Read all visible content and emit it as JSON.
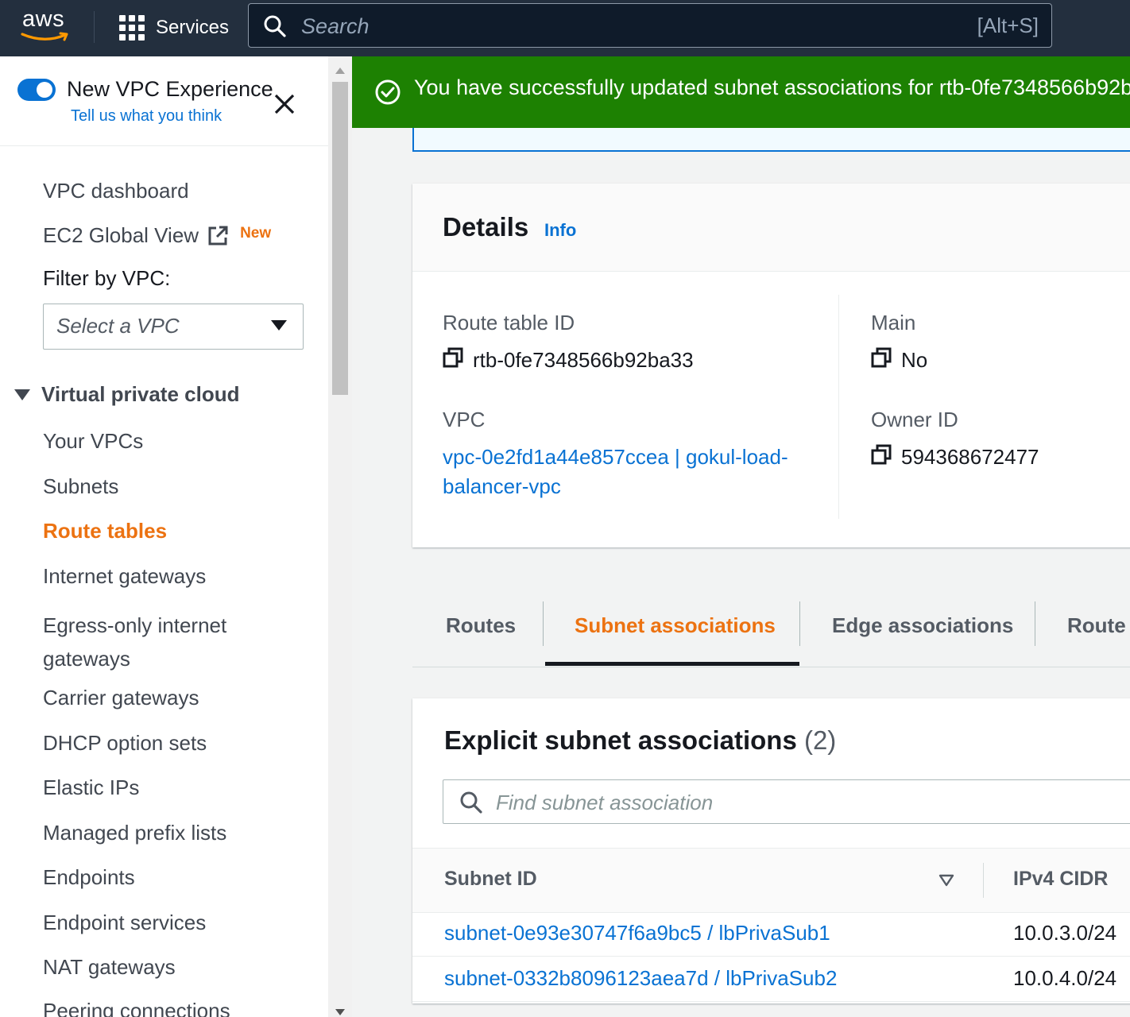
{
  "topnav": {
    "logo_text": "aws",
    "services_label": "Services",
    "search_placeholder": "Search",
    "search_shortcut": "[Alt+S]"
  },
  "sidebar": {
    "toggle_title": "New VPC Experience",
    "toggle_subtitle": "Tell us what you think",
    "toggle_on": true,
    "links_top": [
      {
        "label": "VPC dashboard"
      },
      {
        "label": "EC2 Global View",
        "badge": "New"
      }
    ],
    "filter_label": "Filter by VPC:",
    "filter_placeholder": "Select a VPC",
    "section_title": "Virtual private cloud",
    "items": [
      {
        "label": "Your VPCs"
      },
      {
        "label": "Subnets"
      },
      {
        "label": "Route tables",
        "active": true
      },
      {
        "label": "Internet gateways"
      },
      {
        "label": "Egress-only internet gateways"
      },
      {
        "label": "Carrier gateways"
      },
      {
        "label": "DHCP option sets"
      },
      {
        "label": "Elastic IPs"
      },
      {
        "label": "Managed prefix lists"
      },
      {
        "label": "Endpoints"
      },
      {
        "label": "Endpoint services"
      },
      {
        "label": "NAT gateways"
      },
      {
        "label": "Peering connections"
      }
    ]
  },
  "flash": {
    "status": "success",
    "message": "You have successfully updated subnet associations for rtb-0fe7348566b92b"
  },
  "details": {
    "title": "Details",
    "info_label": "Info",
    "route_table_id_label": "Route table ID",
    "route_table_id": "rtb-0fe7348566b92ba33",
    "vpc_label": "VPC",
    "vpc_value": "vpc-0e2fd1a44e857ccea | gokul-load-balancer-vpc",
    "main_label": "Main",
    "main_value": "No",
    "owner_label": "Owner ID",
    "owner_value": "594368672477"
  },
  "tabs": [
    {
      "label": "Routes"
    },
    {
      "label": "Subnet associations",
      "active": true
    },
    {
      "label": "Edge associations"
    },
    {
      "label": "Route"
    }
  ],
  "associations": {
    "title": "Explicit subnet associations",
    "count": "(2)",
    "search_placeholder": "Find subnet association",
    "columns": [
      "Subnet ID",
      "IPv4 CIDR"
    ],
    "rows": [
      {
        "subnet": "subnet-0e93e30747f6a9bc5 / lbPrivaSub1",
        "cidr": "10.0.3.0/24"
      },
      {
        "subnet": "subnet-0332b8096123aea7d / lbPrivaSub2",
        "cidr": "10.0.4.0/24"
      }
    ]
  },
  "colors": {
    "accent": "#ec7211",
    "link": "#0972d3",
    "success": "#1d8102",
    "nav_bg": "#232f3e"
  }
}
